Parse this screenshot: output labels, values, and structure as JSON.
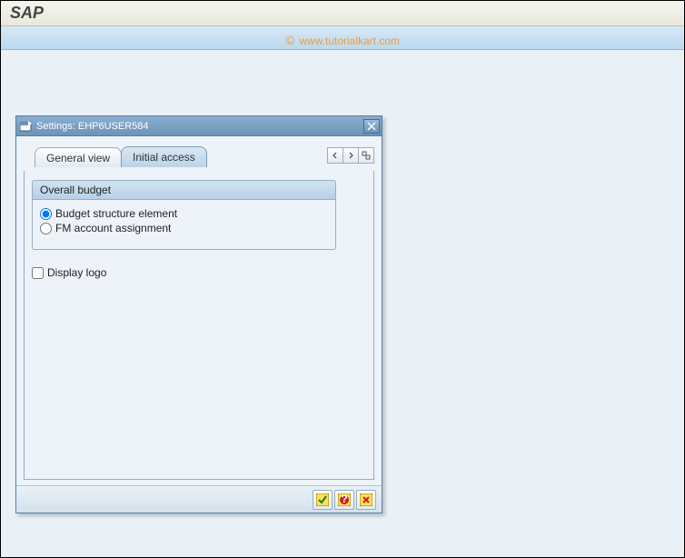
{
  "app": {
    "title": "SAP"
  },
  "watermark": {
    "copy": "©",
    "text": "www.tutorialkart.com"
  },
  "dialog": {
    "title": "Settings: EHP6USER584",
    "tabs": {
      "general": "General view",
      "initial": "Initial access"
    },
    "groupbox": {
      "title": "Overall budget",
      "opt_bse": "Budget structure element",
      "opt_fm": "FM account assignment"
    },
    "display_logo": "Display logo"
  }
}
